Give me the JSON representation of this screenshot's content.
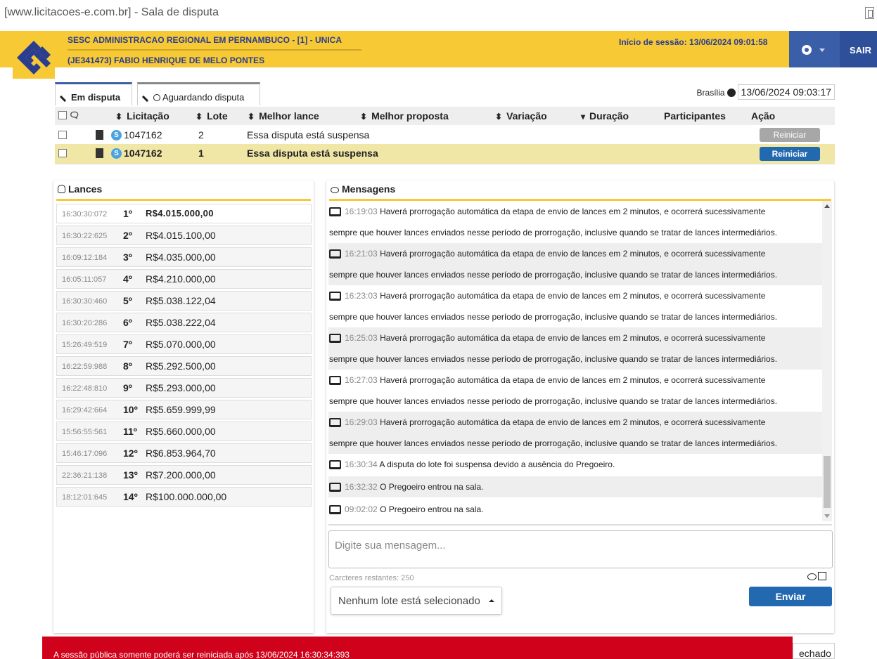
{
  "window": {
    "title": "[www.licitacoes-e.com.br] - Sala de disputa"
  },
  "header": {
    "org": "SESC ADMINISTRACAO REGIONAL EM PERNAMBUCO - [1] - UNICA",
    "user": "(JE341473) FABIO HENRIQUE DE MELO PONTES",
    "session": "Início de sessão: 13/06/2024 09:01:58",
    "exit_label": "SAIR",
    "colors": {
      "bar": "#f7c935",
      "button": "#3a5ea8"
    }
  },
  "tabs": [
    {
      "label": "Em disputa",
      "icon": "gavel-icon",
      "active": true
    },
    {
      "label": "Aguardando disputa",
      "icon": "gavel-clock-icon",
      "active": false
    }
  ],
  "clock": {
    "city": "Brasília",
    "datetime": "13/06/2024 09:03:17"
  },
  "table": {
    "columns": [
      "Licitação",
      "Lote",
      "Melhor lance",
      "Melhor proposta",
      "Variação",
      "Duração",
      "Participantes",
      "Ação"
    ],
    "rows": [
      {
        "licitacao": "1047162",
        "lote": "2",
        "status": "Essa disputa está suspensa",
        "action": "Reiniciar",
        "selected": false
      },
      {
        "licitacao": "1047162",
        "lote": "1",
        "status": "Essa disputa está suspensa",
        "action": "Reiniciar",
        "selected": true
      }
    ]
  },
  "lances": {
    "title": "Lances",
    "items": [
      {
        "time": "16:30:30:072",
        "pos": "1º",
        "value": "R$4.015.000,00"
      },
      {
        "time": "16:30:22:625",
        "pos": "2º",
        "value": "R$4.015.100,00"
      },
      {
        "time": "16:09:12:184",
        "pos": "3º",
        "value": "R$4.035.000,00"
      },
      {
        "time": "16:05:11:057",
        "pos": "4º",
        "value": "R$4.210.000,00"
      },
      {
        "time": "16:30:30:460",
        "pos": "5º",
        "value": "R$5.038.122,04"
      },
      {
        "time": "16:30:20:286",
        "pos": "6º",
        "value": "R$5.038.222,04"
      },
      {
        "time": "15:26:49:519",
        "pos": "7º",
        "value": "R$5.070.000,00"
      },
      {
        "time": "16:22:59:988",
        "pos": "8º",
        "value": "R$5.292.500,00"
      },
      {
        "time": "16:22:48:810",
        "pos": "9º",
        "value": "R$5.293.000,00"
      },
      {
        "time": "16:29:42:664",
        "pos": "10º",
        "value": "R$5.659.999,99"
      },
      {
        "time": "15:56:55:561",
        "pos": "11º",
        "value": "R$5.660.000,00"
      },
      {
        "time": "15:46:17:096",
        "pos": "12º",
        "value": "R$6.853.964,70"
      },
      {
        "time": "22:36:21:138",
        "pos": "13º",
        "value": "R$7.200.000,00"
      },
      {
        "time": "18:12:01:645",
        "pos": "14º",
        "value": "R$100.000.000,00"
      }
    ]
  },
  "mensagens": {
    "title": "Mensagens",
    "items": [
      {
        "time": "16:19:03",
        "line1": "Haverá prorrogação automática da etapa de envio de lances em 2 minutos, e ocorrerá sucessivamente",
        "line2": "sempre que houver lances enviados nesse período de prorrogação, inclusive quando se tratar de lances intermediários."
      },
      {
        "time": "16:21:03",
        "line1": "Haverá prorrogação automática da etapa de envio de lances em 2 minutos, e ocorrerá sucessivamente",
        "line2": "sempre que houver lances enviados nesse período de prorrogação, inclusive quando se tratar de lances intermediários."
      },
      {
        "time": "16:23:03",
        "line1": "Haverá prorrogação automática da etapa de envio de lances em 2 minutos, e ocorrerá sucessivamente",
        "line2": "sempre que houver lances enviados nesse período de prorrogação, inclusive quando se tratar de lances intermediários."
      },
      {
        "time": "16:25:03",
        "line1": "Haverá prorrogação automática da etapa de envio de lances em 2 minutos, e ocorrerá sucessivamente",
        "line2": "sempre que houver lances enviados nesse período de prorrogação, inclusive quando se tratar de lances intermediários."
      },
      {
        "time": "16:27:03",
        "line1": "Haverá prorrogação automática da etapa de envio de lances em 2 minutos, e ocorrerá sucessivamente",
        "line2": "sempre que houver lances enviados nesse período de prorrogação, inclusive quando se tratar de lances intermediários."
      },
      {
        "time": "16:29:03",
        "line1": "Haverá prorrogação automática da etapa de envio de lances em 2 minutos, e ocorrerá sucessivamente",
        "line2": "sempre que houver lances enviados nesse período de prorrogação, inclusive quando se tratar de lances intermediários."
      },
      {
        "time": "16:30:34",
        "line1": "A disputa do lote foi suspensa devido a ausência do Pregoeiro.",
        "line2": ""
      },
      {
        "time": "16:32:32",
        "line1": "O Pregoeiro entrou na sala.",
        "line2": ""
      },
      {
        "time": "09:02:02",
        "line1": "O Pregoeiro entrou na sala.",
        "line2": ""
      }
    ],
    "input_placeholder": "Digite sua mensagem...",
    "remaining": "Carcteres restantes: 250",
    "lote_select": "Nenhum lote está selecionado",
    "send_label": "Enviar"
  },
  "footer": {
    "alert": "A sessão pública somente poderá ser reiniciada após 13/06/2024 16:30:34:393",
    "closed_label": "echado",
    "alert_color": "#d0021b"
  }
}
